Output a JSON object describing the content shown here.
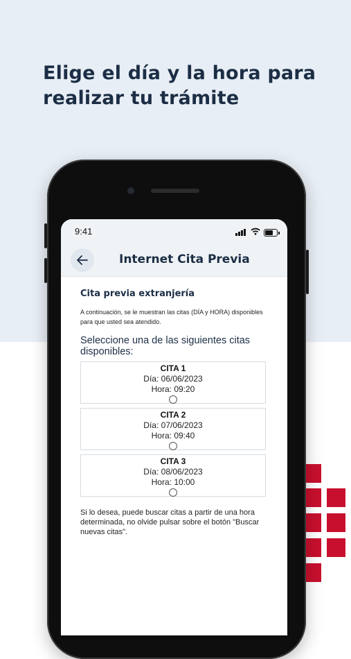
{
  "headline": "Elige el día y la hora para realizar tu trámite",
  "status_bar": {
    "time": "9:41"
  },
  "app_bar": {
    "title": "Internet Cita Previa"
  },
  "content": {
    "section_title": "Cita previa extranjería",
    "intro": "A continuación, se le muestran las citas (DÍA y HORA) disponibles para que usted sea atendido.",
    "select_label": "Seleccione una de las siguientes citas disponibles:",
    "citas": [
      {
        "name": "CITA 1",
        "dia": "Día: 06/06/2023",
        "hora": "Hora: 09:20"
      },
      {
        "name": "CITA 2",
        "dia": "Día: 07/06/2023",
        "hora": "Hora: 09:40"
      },
      {
        "name": "CITA 3",
        "dia": "Día: 08/06/2023",
        "hora": "Hora: 10:00"
      }
    ],
    "footer_note": "Si lo desea, puede buscar citas a partir de una hora determinada, no olvide pulsar sobre el botón \"Buscar nuevas citas\"."
  },
  "colors": {
    "accent": "#1c2e45",
    "brand_red": "#c8102e",
    "background_top": "#e8eef5"
  },
  "icons": {
    "back": "arrow-left-icon",
    "wifi": "wifi-icon",
    "battery": "battery-icon",
    "signal": "signal-icon"
  }
}
